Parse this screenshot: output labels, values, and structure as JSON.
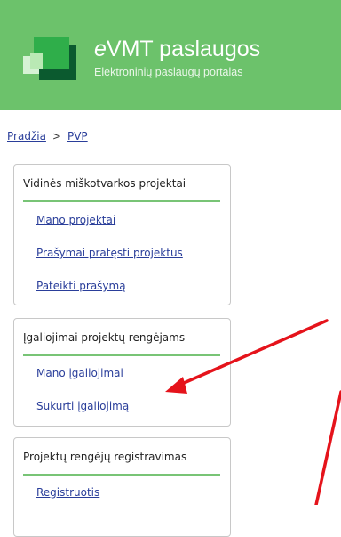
{
  "header": {
    "title_prefix": "e",
    "title_rest": "VMT paslaugos",
    "subtitle": "Elektroninių paslaugų portalas",
    "bg_color": "#6cc26b"
  },
  "breadcrumb": {
    "home": "Pradžia",
    "separator": ">",
    "current": "PVP"
  },
  "cards": [
    {
      "title": "Vidinės miškotvarkos projektai",
      "links": [
        "Mano projektai",
        "Prašymai pratęsti projektus",
        "Pateikti prašymą"
      ]
    },
    {
      "title": "Įgaliojimai projektų rengėjams",
      "links": [
        "Mano įgaliojimai",
        "Sukurti įgaliojimą"
      ]
    },
    {
      "title": "Projektų rengėjų registravimas",
      "links": [
        "Registruotis"
      ]
    }
  ],
  "colors": {
    "link": "#2a3e9a",
    "accent_rule": "#78c476",
    "annotation_arrow": "#e5131b"
  },
  "icons": [
    "evmt-logo-icon",
    "chevron-right-icon",
    "red-arrow-annotation"
  ]
}
